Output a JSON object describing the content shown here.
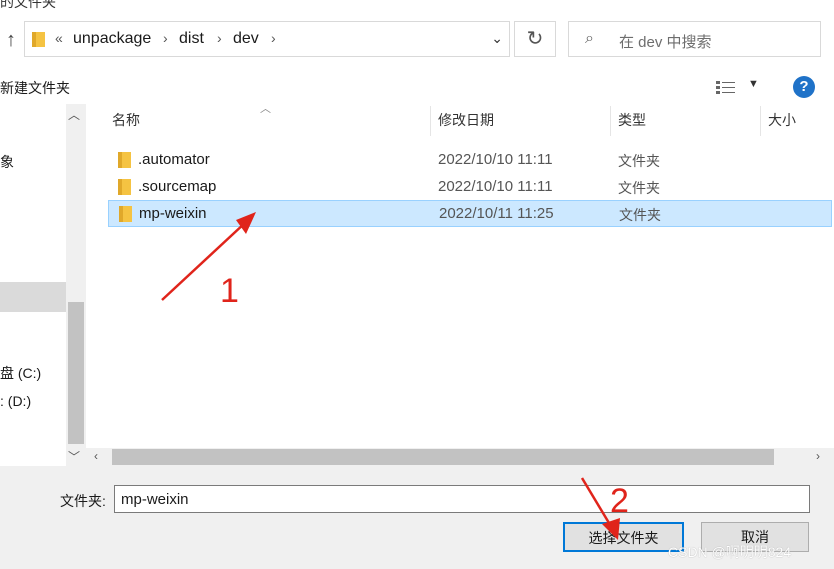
{
  "window": {
    "title_fragment": "的文件夹"
  },
  "address_bar": {
    "overflow": "«",
    "segments": [
      "unpackage",
      "dist",
      "dev"
    ],
    "separator": "›"
  },
  "search": {
    "placeholder": "在 dev 中搜索"
  },
  "toolbar": {
    "new_folder": "新建文件夹",
    "help": "?"
  },
  "nav": {
    "items": [
      {
        "label": "象"
      },
      {
        "label": "盘 (C:)"
      },
      {
        "label": ": (D:)"
      }
    ]
  },
  "columns": {
    "name": "名称",
    "date": "修改日期",
    "type": "类型",
    "size": "大小"
  },
  "files": [
    {
      "name": ".automator",
      "date": "2022/10/10 11:11",
      "type": "文件夹"
    },
    {
      "name": ".sourcemap",
      "date": "2022/10/10 11:11",
      "type": "文件夹"
    },
    {
      "name": "mp-weixin",
      "date": "2022/10/11 11:25",
      "type": "文件夹"
    }
  ],
  "footer": {
    "folder_label": "文件夹:",
    "folder_value": "mp-weixin",
    "select_button": "选择文件夹",
    "cancel_button": "取消"
  },
  "annotations": {
    "step1": "1",
    "step2": "2"
  },
  "watermark": "CSDN @啊明明824",
  "colors": {
    "selection": "#cce8ff",
    "accent": "#0078d7",
    "annotation": "#e0241b",
    "folder": "#f5c342"
  }
}
